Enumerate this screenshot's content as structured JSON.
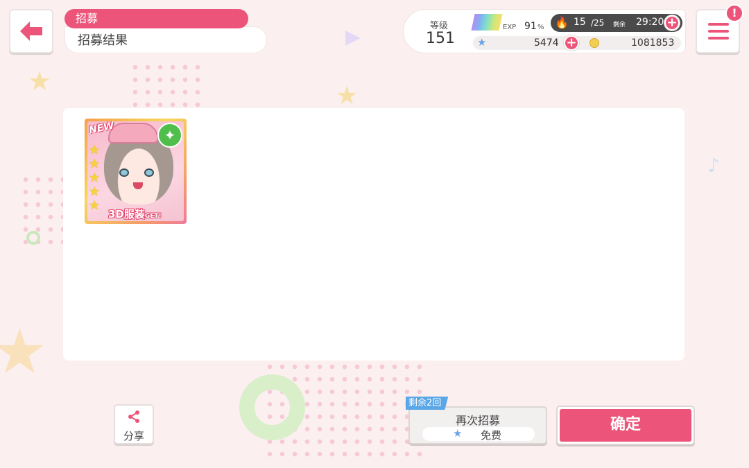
{
  "header": {
    "section_tag": "招募",
    "title": "招募结果"
  },
  "status": {
    "level_label": "等级",
    "level_value": "151",
    "exp_label": "EXP",
    "exp_value": "91",
    "exp_unit": "%",
    "stamina_current": "15",
    "stamina_max": "/25",
    "stamina_remain_label": "剩余",
    "stamina_timer": "29:20",
    "star_gems": "5474",
    "coins": "1081853"
  },
  "icons": {
    "back": "left-arrow-icon",
    "menu": "hamburger-menu-icon",
    "alert": "!",
    "plus": "+",
    "share": "share-icon"
  },
  "result": {
    "cards": [
      {
        "badge": "NEW",
        "rarity_stars": 5,
        "attribute": "✦",
        "bonus_label": "3D服装",
        "bonus_suffix": "GET!"
      }
    ]
  },
  "footer": {
    "share_label": "分享",
    "remain_label": "剩余2回",
    "again_label": "再次招募",
    "again_cost": "免费",
    "confirm_label": "确定"
  },
  "colors": {
    "accent": "#ec5579",
    "background": "#fcefef",
    "panel": "#ffffff",
    "remain_tag": "#5aa6e6"
  }
}
